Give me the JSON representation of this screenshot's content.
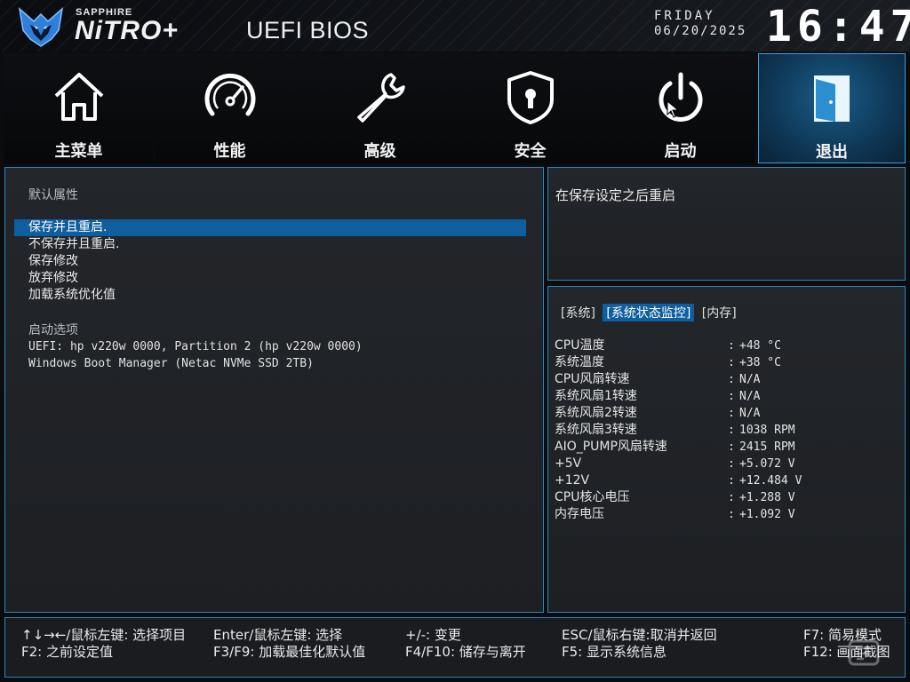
{
  "header": {
    "brand_top": "SAPPHIRE",
    "brand_main": "NiTRO+",
    "title": "UEFI BIOS",
    "day": "FRIDAY",
    "date": "06/20/2025",
    "time": "16:47"
  },
  "tabs": [
    {
      "label": "主菜单",
      "icon": "home-icon"
    },
    {
      "label": "性能",
      "icon": "speedometer-icon"
    },
    {
      "label": "高级",
      "icon": "wrench-icon"
    },
    {
      "label": "安全",
      "icon": "shield-lock-icon"
    },
    {
      "label": "启动",
      "icon": "power-icon"
    },
    {
      "label": "退出",
      "icon": "exit-door-icon",
      "active": true
    }
  ],
  "exit_menu": {
    "section_title": "默认属性",
    "items": [
      {
        "label": "保存并且重启.",
        "selected": true
      },
      {
        "label": "不保存并且重启."
      },
      {
        "label": "保存修改"
      },
      {
        "label": "放弃修改"
      },
      {
        "label": "加载系统优化值"
      }
    ],
    "boot_section_title": "启动选项",
    "boot_items": [
      "UEFI: hp v220w 0000, Partition 2 (hp v220w 0000)",
      "Windows Boot Manager (Netac NVMe SSD 2TB)"
    ]
  },
  "help": {
    "text": "在保存设定之后重启"
  },
  "status": {
    "subtabs": [
      "[系统]",
      "[系统状态监控]",
      "[内存]"
    ],
    "active_subtab": 1,
    "rows": [
      {
        "label": "CPU温度",
        "value": "+48 °C"
      },
      {
        "label": "系统温度",
        "value": "+38 °C"
      },
      {
        "label": "CPU风扇转速",
        "value": "N/A"
      },
      {
        "label": "系统风扇1转速",
        "value": "N/A"
      },
      {
        "label": "系统风扇2转速",
        "value": "N/A"
      },
      {
        "label": "系统风扇3转速",
        "value": "1038 RPM"
      },
      {
        "label": "AIO_PUMP风扇转速",
        "value": "2415 RPM"
      },
      {
        "label": "+5V",
        "value": "+5.072 V"
      },
      {
        "label": "+12V",
        "value": "+12.484 V"
      },
      {
        "label": "CPU核心电压",
        "value": "+1.288 V"
      },
      {
        "label": "内存电压",
        "value": "+1.092 V"
      }
    ]
  },
  "footer": {
    "row1": [
      "↑↓→←/鼠标左键: 选择项目",
      "Enter/鼠标左键: 选择",
      "+/-: 变更",
      "ESC/鼠标右键:取消并返回",
      "F7: 简易模式"
    ],
    "row2": [
      "F2: 之前设定值",
      "F3/F9: 加载最佳化默认值",
      "F4/F10: 储存与离开",
      "F5: 显示系统信息",
      "F12: 画面截图"
    ]
  },
  "colors": {
    "accent": "#0f5e9e",
    "border": "#2f86b8",
    "panel": "#1f2226"
  }
}
